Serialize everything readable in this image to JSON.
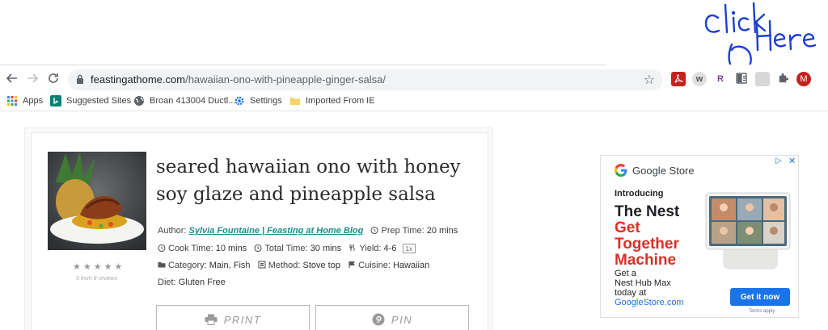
{
  "annotation": {
    "text": "Click Here"
  },
  "browser": {
    "url_host": "feastingathome.com",
    "url_path": "/hawaiian-ono-with-pineapple-ginger-salsa/",
    "extensions": [
      {
        "name": "pdf-extension-icon",
        "label": ""
      },
      {
        "name": "w-extension-icon",
        "label": "w"
      },
      {
        "name": "r-extension-icon",
        "label": "R"
      },
      {
        "name": "reader-mode-icon",
        "label": ""
      },
      {
        "name": "grey-extension-icon",
        "label": ""
      },
      {
        "name": "puzzle-extensions-icon",
        "label": ""
      },
      {
        "name": "profile-avatar",
        "label": "M"
      }
    ],
    "bookmarks": [
      "Apps",
      "Suggested Sites",
      "Broan 413004 Ductl...",
      "Settings",
      "Imported From IE"
    ]
  },
  "recipe": {
    "title_line1": "seared hawaiian ono with honey",
    "title_line2": "soy glaze and pineapple salsa",
    "rating_stars": "★★★★★",
    "reviews": "5 from 8 reviews",
    "author_label": "Author:",
    "author": "Sylvia Fountaine | Feasting at Home Blog",
    "prep_label": "Prep Time:",
    "prep": "20 mins",
    "cook_label": "Cook Time:",
    "cook": "10 mins",
    "total_label": "Total Time:",
    "total": "30 mins",
    "yield_label": "Yield:",
    "yield": "4-6",
    "scale": "1x",
    "category_label": "Category:",
    "category": "Main, Fish",
    "method_label": "Method:",
    "method": "Stove top",
    "cuisine_label": "Cuisine:",
    "cuisine": "Hawaiian",
    "diet_label": "Diet:",
    "diet": "Gluten Free",
    "print_label": "PRINT",
    "pin_label": "PIN"
  },
  "ad": {
    "brand": "Google Store",
    "intro": "Introducing",
    "headline_1": "The Nest",
    "headline_2": "Get",
    "headline_3": "Together",
    "headline_4": "Machine",
    "body_1": "Get a",
    "body_2": "Nest Hub Max",
    "body_3": "today at",
    "body_link": "GoogleStore.com",
    "cta": "Get it now",
    "terms": "Terms apply"
  },
  "colors": {
    "accent_blue": "#1a73e8",
    "ad_red": "#d93025",
    "author_teal": "#1e8a8a",
    "annotation_blue": "#1b3fd1"
  }
}
